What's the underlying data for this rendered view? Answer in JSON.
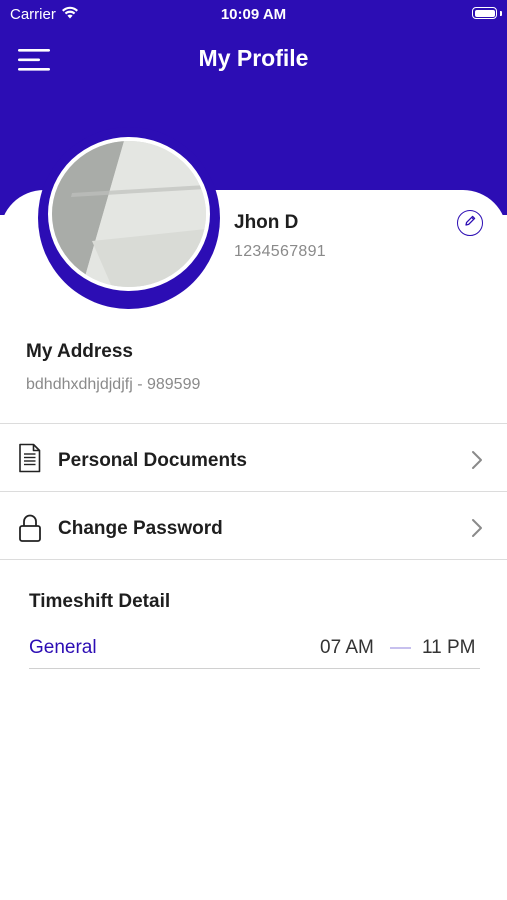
{
  "status_bar": {
    "carrier": "Carrier",
    "time": "10:09 AM",
    "wifi_icon": "wifi-icon",
    "battery_icon": "battery-icon",
    "battery_level": 1.0
  },
  "header": {
    "title": "My Profile",
    "menu_icon": "hamburger-menu-icon",
    "background_color": "#2c0db4"
  },
  "profile": {
    "name": "Jhon D",
    "phone": "1234567891",
    "edit_icon": "pencil-icon"
  },
  "address": {
    "title": "My Address",
    "value": "bdhdhxdhjdjdjfj - 989599"
  },
  "menu": {
    "items": [
      {
        "label": "Personal Documents",
        "icon": "document-icon"
      },
      {
        "label": "Change Password",
        "icon": "lock-icon"
      }
    ],
    "chevron_icon": "chevron-right-icon"
  },
  "timeshift": {
    "title": "Timeshift Detail",
    "shift_name": "General",
    "start": "07 AM",
    "end": "11 PM",
    "accent_color": "#2c0db4"
  }
}
